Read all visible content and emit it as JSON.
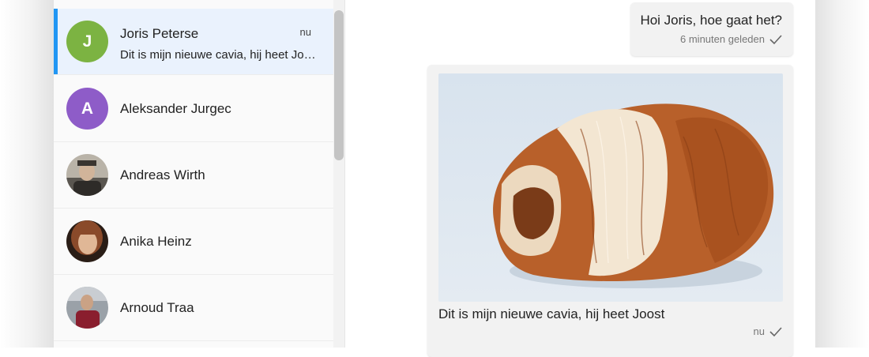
{
  "contacts": [
    {
      "initial": "J",
      "name": "Joris Peterse",
      "time": "nu",
      "preview": "Dit is mijn nieuwe cavia, hij heet Joost",
      "avatar_color": "#7cb342",
      "active": true
    },
    {
      "initial": "A",
      "name": "Aleksander Jurgec",
      "avatar_color": "#8e5cc8"
    },
    {
      "name": "Andreas Wirth",
      "avatar_icon": "user-photo"
    },
    {
      "name": "Anika Heinz",
      "avatar_icon": "user-photo"
    },
    {
      "name": "Arnoud Traa",
      "avatar_icon": "user-photo"
    }
  ],
  "messages": [
    {
      "text": "Hoi Joris, hoe gaat het?",
      "time": "6 minuten geleden",
      "status_icon": "check-icon"
    },
    {
      "image": "guinea-pig-photo",
      "caption": "Dit is mijn nieuwe cavia, hij heet Joost",
      "time": "nu",
      "status_icon": "check-icon"
    }
  ],
  "colors": {
    "accent": "#2196f3",
    "active_row": "#eaf2fd",
    "bubble": "#f2f2f2"
  }
}
